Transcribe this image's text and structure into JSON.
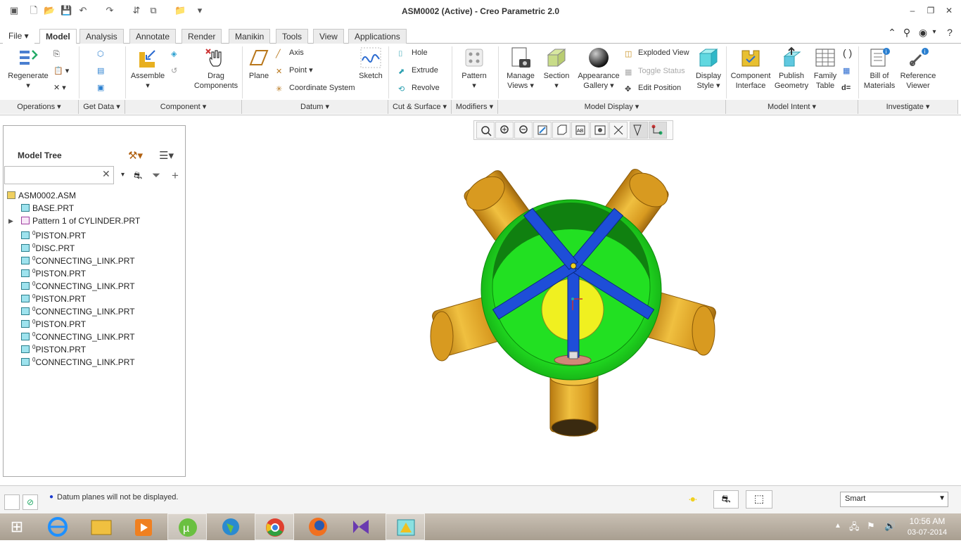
{
  "window": {
    "title": "ASM0002 (Active) - Creo Parametric 2.0"
  },
  "tabs": [
    "File",
    "Model",
    "Analysis",
    "Annotate",
    "Render",
    "Manikin",
    "Tools",
    "View",
    "Applications"
  ],
  "ribbon": {
    "regenerate": "Regenerate",
    "assemble": "Assemble",
    "drag_components": [
      "Drag",
      "Components"
    ],
    "plane": "Plane",
    "axis": "Axis",
    "point": "Point",
    "coordinate_system": "Coordinate System",
    "sketch": "Sketch",
    "hole": "Hole",
    "extrude": "Extrude",
    "revolve": "Revolve",
    "pattern": "Pattern",
    "manage_views": [
      "Manage",
      "Views"
    ],
    "section": "Section",
    "appearance_gallery": [
      "Appearance",
      "Gallery"
    ],
    "exploded_view": "Exploded View",
    "toggle_status": "Toggle Status",
    "edit_position": "Edit Position",
    "display_style": [
      "Display",
      "Style"
    ],
    "component_interface": [
      "Component",
      "Interface"
    ],
    "publish_geometry": [
      "Publish",
      "Geometry"
    ],
    "family_table": [
      "Family",
      "Table"
    ],
    "bill_of_materials": [
      "Bill of",
      "Materials"
    ],
    "reference_viewer": [
      "Reference",
      "Viewer"
    ]
  },
  "groups": [
    "Operations",
    "Get Data",
    "Component",
    "Datum",
    "Cut & Surface",
    "Modifiers",
    "Model Display",
    "Model Intent",
    "Investigate"
  ],
  "model_tree": {
    "title": "Model Tree",
    "root": "ASM0002.ASM",
    "items": [
      {
        "name": "BASE.PRT",
        "flag": ""
      },
      {
        "name": "Pattern 1 of CYLINDER.PRT",
        "flag": ""
      },
      {
        "name": "PISTON.PRT",
        "flag": "0"
      },
      {
        "name": "DISC.PRT",
        "flag": "0"
      },
      {
        "name": "CONNECTING_LINK.PRT",
        "flag": "0"
      },
      {
        "name": "PISTON.PRT",
        "flag": "0"
      },
      {
        "name": "CONNECTING_LINK.PRT",
        "flag": "0"
      },
      {
        "name": "PISTON.PRT",
        "flag": "0"
      },
      {
        "name": "CONNECTING_LINK.PRT",
        "flag": "0"
      },
      {
        "name": "PISTON.PRT",
        "flag": "0"
      },
      {
        "name": "CONNECTING_LINK.PRT",
        "flag": "0"
      },
      {
        "name": "PISTON.PRT",
        "flag": "0"
      },
      {
        "name": "CONNECTING_LINK.PRT",
        "flag": "0"
      }
    ]
  },
  "status": {
    "message": "Datum planes will not be displayed.",
    "filter": "Smart"
  },
  "clock": {
    "time": "10:56 AM",
    "date": "03-07-2014"
  },
  "colors": {
    "ring": "#22e022",
    "spider": "#1e4ed8",
    "cylinder": "#e0a020",
    "disc": "#f0f020"
  }
}
